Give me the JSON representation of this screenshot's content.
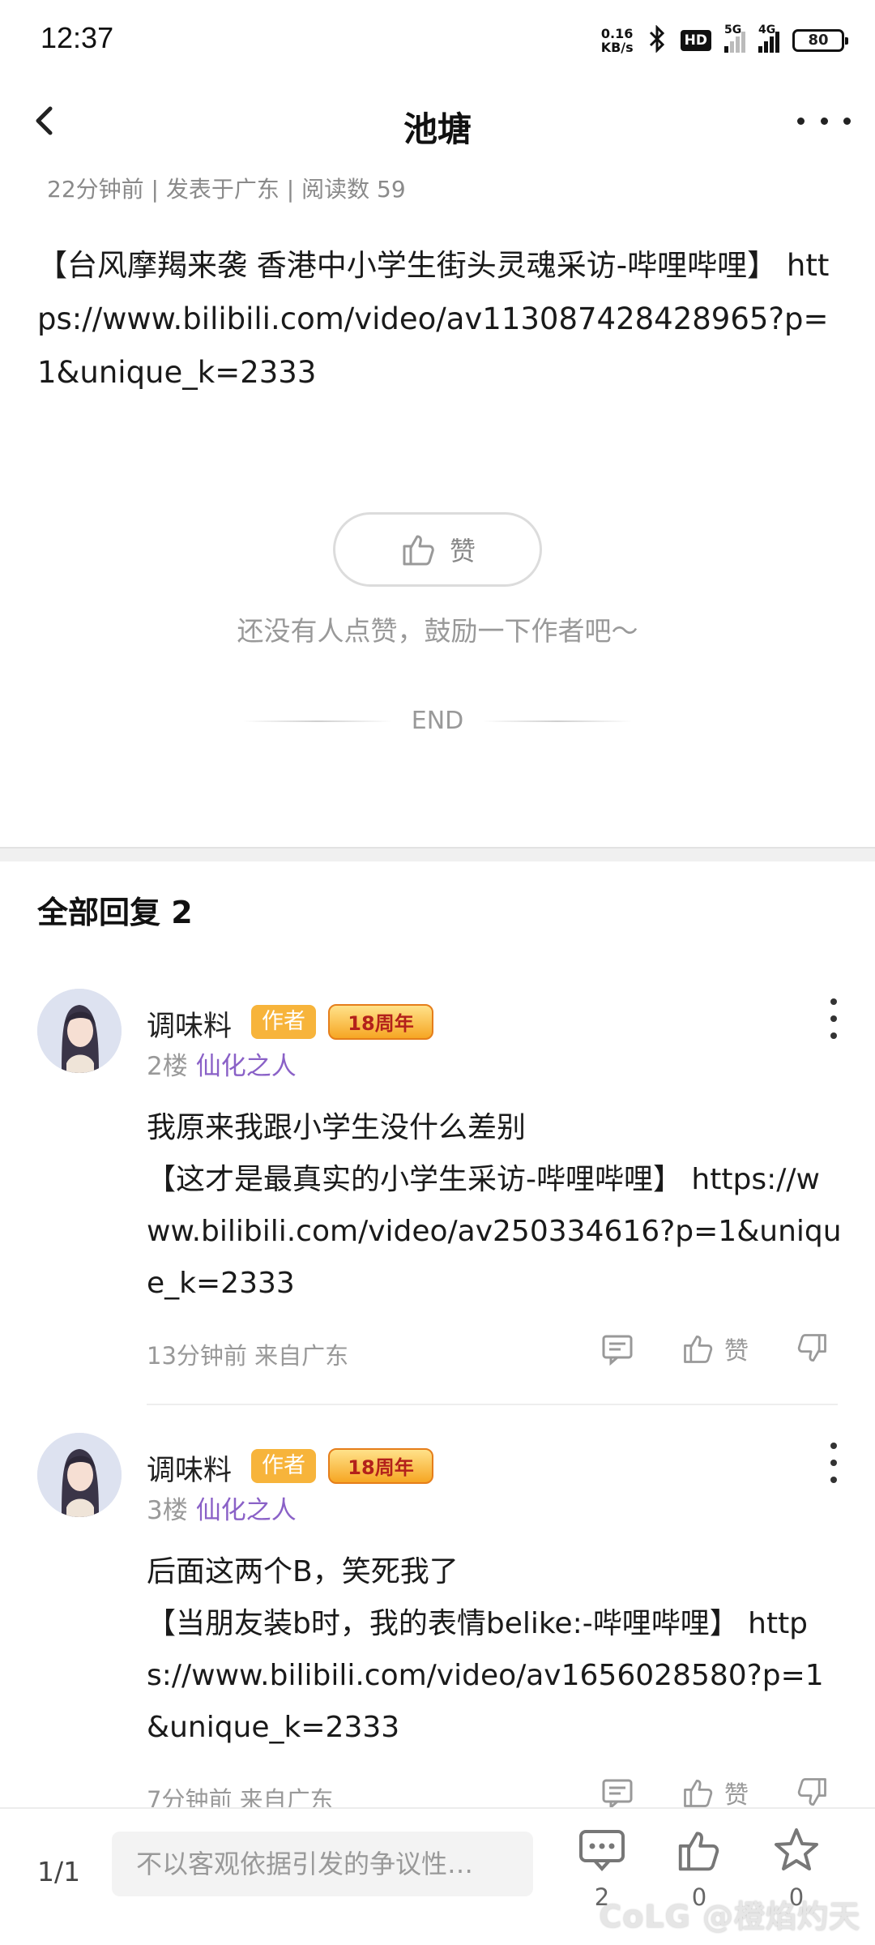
{
  "status_bar": {
    "time": "12:37",
    "net_speed_value": "0.16",
    "net_speed_unit": "KB/s",
    "hd_label": "HD",
    "sig1_label": "5G",
    "sig2_label": "4G",
    "battery": "80",
    "bluetooth_icon": "bluetooth-icon"
  },
  "header": {
    "title": "池塘",
    "back_icon": "chevron-left-icon",
    "more_icon": "more-horizontal-icon"
  },
  "post": {
    "meta": "22分钟前 | 发表于广东 | 阅读数 59",
    "body": "【台风摩羯来袭 香港中小学生街头灵魂采访-哔哩哔哩】 https://www.bilibili.com/video/av113087428428965?p=1&unique_k=2333",
    "like_label": "赞",
    "like_hint": "还没有人点赞，鼓励一下作者吧～",
    "end_label": "END"
  },
  "replies": {
    "header": "全部回复  2",
    "items": [
      {
        "name": "调味料",
        "author_tag": "作者",
        "anniv_tag": "18周年",
        "floor": "2楼",
        "user_title": "仙化之人",
        "content": "我原来我跟小学生没什么差别\n【这才是最真实的小学生采访-哔哩哔哩】 https://www.bilibili.com/video/av250334616?p=1&unique_k=2333",
        "time": "13分钟前 来自广东",
        "like_label": "赞"
      },
      {
        "name": "调味料",
        "author_tag": "作者",
        "anniv_tag": "18周年",
        "floor": "3楼",
        "user_title": "仙化之人",
        "content": "后面这两个B，笑死我了\n【当朋友装b时，我的表情belike:-哔哩哔哩】 https://www.bilibili.com/video/av1656028580?p=1&unique_k=2333",
        "time": "7分钟前 来自广东",
        "like_label": "赞"
      }
    ]
  },
  "bottom_bar": {
    "page_indicator": "1/1",
    "input_placeholder": "不以客观依据引发的争议性…",
    "comment_count": "2",
    "like_count": "0",
    "fav_count": "0",
    "watermark": "CoLG @橙焰灼天"
  }
}
